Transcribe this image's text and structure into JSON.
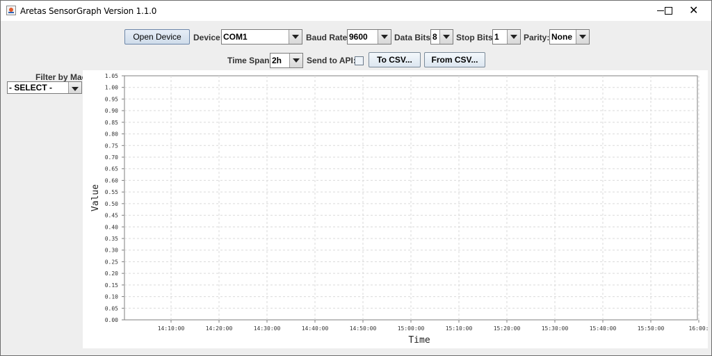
{
  "window": {
    "title": "Aretas SensorGraph Version 1.1.0",
    "close_glyph": "✕"
  },
  "toolbar": {
    "open_device": "Open Device",
    "device_label": "Device:",
    "device_value": "COM1",
    "baud_label": "Baud Rate:",
    "baud_value": "9600",
    "databits_label": "Data Bits:",
    "databits_value": "8",
    "stopbits_label": "Stop Bits:",
    "stopbits_value": "1",
    "parity_label": "Parity:",
    "parity_value": "None",
    "timespan_label": "Time Span:",
    "timespan_value": "2h",
    "send_api_label": "Send to API:",
    "send_api_checked": false,
    "to_csv": "To CSV...",
    "from_csv": "From CSV..."
  },
  "filter": {
    "label": "Filter by Mac:",
    "value": "- SELECT -"
  },
  "chart_data": {
    "type": "line",
    "title": "",
    "xlabel": "Time",
    "ylabel": "Value",
    "ylim": [
      0,
      1.05
    ],
    "yticks": [
      "0.00",
      "0.05",
      "0.10",
      "0.15",
      "0.20",
      "0.25",
      "0.30",
      "0.35",
      "0.40",
      "0.45",
      "0.50",
      "0.55",
      "0.60",
      "0.65",
      "0.70",
      "0.75",
      "0.80",
      "0.85",
      "0.90",
      "0.95",
      "1.00",
      "1.05"
    ],
    "xticks": [
      "14:10:00",
      "14:20:00",
      "14:30:00",
      "14:40:00",
      "14:50:00",
      "15:00:00",
      "15:10:00",
      "15:20:00",
      "15:30:00",
      "15:40:00",
      "15:50:00",
      "16:00:"
    ],
    "grid": true,
    "series": []
  },
  "colors": {
    "grid": "#d9d9d9",
    "axis": "#7f7f7f",
    "plot_bg": "#ffffff"
  }
}
